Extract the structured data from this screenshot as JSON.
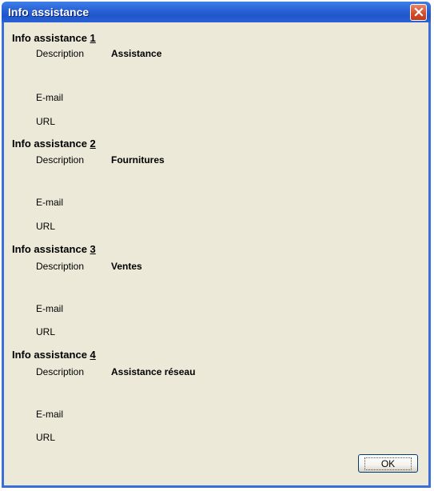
{
  "window": {
    "title": "Info assistance",
    "close_icon": "close-icon"
  },
  "groups": [
    {
      "prefix": "Info assistance ",
      "number": "1",
      "description_label": "Description",
      "description_value": "Assistance",
      "email_label": "E-mail",
      "url_label": "URL"
    },
    {
      "prefix": "Info assistance ",
      "number": "2",
      "description_label": "Description",
      "description_value": "Fournitures",
      "email_label": "E-mail",
      "url_label": "URL"
    },
    {
      "prefix": "Info assistance ",
      "number": "3",
      "description_label": "Description",
      "description_value": "Ventes",
      "email_label": "E-mail",
      "url_label": "URL"
    },
    {
      "prefix": "Info assistance ",
      "number": "4",
      "description_label": "Description",
      "description_value": "Assistance réseau",
      "email_label": "E-mail",
      "url_label": "URL"
    }
  ],
  "buttons": {
    "ok_label": "OK"
  },
  "colors": {
    "title_bar": "#2a63d6",
    "dialog_background": "#ece9d8",
    "close_button": "#d14a2a"
  }
}
